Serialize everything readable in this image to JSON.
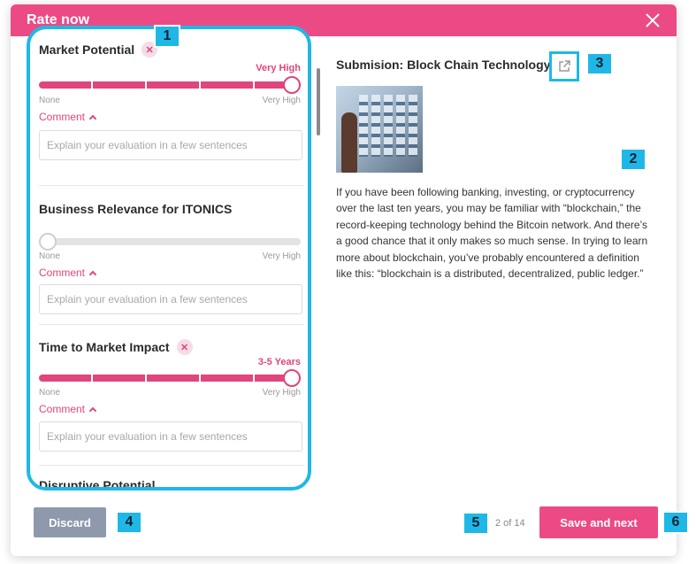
{
  "modal": {
    "title": "Rate now"
  },
  "criteria": [
    {
      "title": "Market Potential",
      "has_clear": true,
      "value_label": "Very High",
      "value_fraction": 1.0,
      "scale_min": "None",
      "scale_max": "Very High",
      "comment_label": "Comment",
      "comment_placeholder": "Explain your evaluation in a few sentences"
    },
    {
      "title": "Business Relevance for ITONICS",
      "has_clear": false,
      "value_label": "",
      "value_fraction": 0.0,
      "scale_min": "None",
      "scale_max": "Very High",
      "comment_label": "Comment",
      "comment_placeholder": "Explain your evaluation in a few sentences"
    },
    {
      "title": "Time to Market Impact",
      "has_clear": true,
      "value_label": "3-5 Years",
      "value_fraction": 1.0,
      "scale_min": "None",
      "scale_max": "Very High",
      "comment_label": "Comment",
      "comment_placeholder": "Explain your evaluation in a few sentences"
    },
    {
      "title": "Disruptive Potential"
    }
  ],
  "submission": {
    "title": "Submision: Block Chain Technology",
    "body": "If you have been following banking, investing, or cryptocurrency over the last ten years, you may be familiar with “blockchain,” the record-keeping technology behind the Bitcoin network. And there’s a good chance that it only makes so much sense. In trying to learn more about blockchain, you’ve probably encountered a definition like this: “blockchain is a distributed, decentralized, public ledger.”"
  },
  "footer": {
    "discard_label": "Discard",
    "page_count": "2 of 14",
    "save_label": "Save and next"
  },
  "callouts": [
    "1",
    "2",
    "3",
    "4",
    "5",
    "6"
  ],
  "colors": {
    "accent": "#ec4a85",
    "highlight": "#1fb8e6",
    "discard": "#8e9aac"
  }
}
